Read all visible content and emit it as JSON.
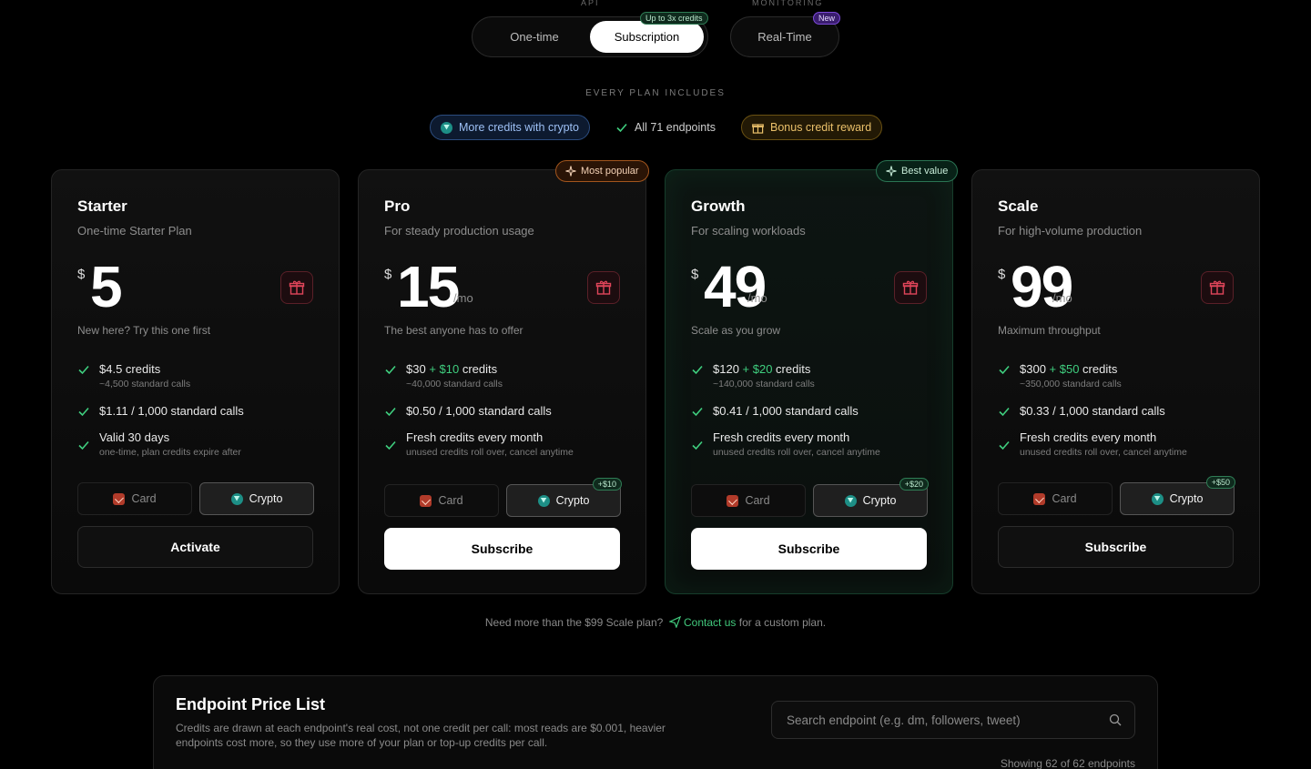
{
  "toggles": {
    "api_label": "API",
    "monitoring_label": "MONITORING",
    "one_time": "One-time",
    "subscription": "Subscription",
    "subscription_tag": "Up to 3x credits",
    "real_time": "Real-Time",
    "real_time_tag": "New"
  },
  "includes": {
    "label": "EVERY PLAN INCLUDES",
    "crypto": "More credits with crypto",
    "endpoints": "All 71 endpoints",
    "bonus": "Bonus credit reward"
  },
  "plans": [
    {
      "name": "Starter",
      "desc": "One-time Starter Plan",
      "currency": "$",
      "amount": "5",
      "per": "",
      "tagline": "New here? Try this one first",
      "f1_base": "$4.5",
      "f1_bonus": "",
      "f1_suffix": " credits",
      "f1_sub": "~4,500 standard calls",
      "f2": "$1.11 / 1,000 standard calls",
      "f3": "Valid 30 days",
      "f3_sub": "one-time, plan credits expire after",
      "card_label": "Card",
      "crypto_label": "Crypto",
      "crypto_bonus": "",
      "cta": "Activate",
      "badge": ""
    },
    {
      "name": "Pro",
      "desc": "For steady production usage",
      "currency": "$",
      "amount": "15",
      "per": "/mo",
      "tagline": "The best anyone has to offer",
      "f1_base": "$30",
      "f1_bonus": " + $10",
      "f1_suffix": " credits",
      "f1_sub": "~40,000 standard calls",
      "f2": "$0.50 / 1,000 standard calls",
      "f3": "Fresh credits every month",
      "f3_sub": "unused credits roll over, cancel anytime",
      "card_label": "Card",
      "crypto_label": "Crypto",
      "crypto_bonus": "+$10",
      "cta": "Subscribe",
      "badge": "Most popular"
    },
    {
      "name": "Growth",
      "desc": "For scaling workloads",
      "currency": "$",
      "amount": "49",
      "per": "/mo",
      "tagline": "Scale as you grow",
      "f1_base": "$120",
      "f1_bonus": " + $20",
      "f1_suffix": " credits",
      "f1_sub": "~140,000 standard calls",
      "f2": "$0.41 / 1,000 standard calls",
      "f3": "Fresh credits every month",
      "f3_sub": "unused credits roll over, cancel anytime",
      "card_label": "Card",
      "crypto_label": "Crypto",
      "crypto_bonus": "+$20",
      "cta": "Subscribe",
      "badge": "Best value"
    },
    {
      "name": "Scale",
      "desc": "For high-volume production",
      "currency": "$",
      "amount": "99",
      "per": "/mo",
      "tagline": "Maximum throughput",
      "f1_base": "$300",
      "f1_bonus": " + $50",
      "f1_suffix": " credits",
      "f1_sub": "~350,000 standard calls",
      "f2": "$0.33 / 1,000 standard calls",
      "f3": "Fresh credits every month",
      "f3_sub": "unused credits roll over, cancel anytime",
      "card_label": "Card",
      "crypto_label": "Crypto",
      "crypto_bonus": "+$50",
      "cta": "Subscribe",
      "badge": ""
    }
  ],
  "custom": {
    "prefix": "Need more than the $99 Scale plan?",
    "link": "Contact us",
    "suffix": "for a custom plan."
  },
  "price_list": {
    "title": "Endpoint Price List",
    "desc": "Credits are drawn at each endpoint's real cost, not one credit per call: most reads are $0.001, heavier endpoints cost more, so they use more of your plan or top-up credits per call.",
    "search_placeholder": "Search endpoint (e.g. dm, followers, tweet)",
    "showing": "Showing 62 of 62 endpoints"
  },
  "colors": {
    "accent_green": "#3fcf7f",
    "gift_red": "#e0455a",
    "crypto_teal": "#1d8f86"
  }
}
